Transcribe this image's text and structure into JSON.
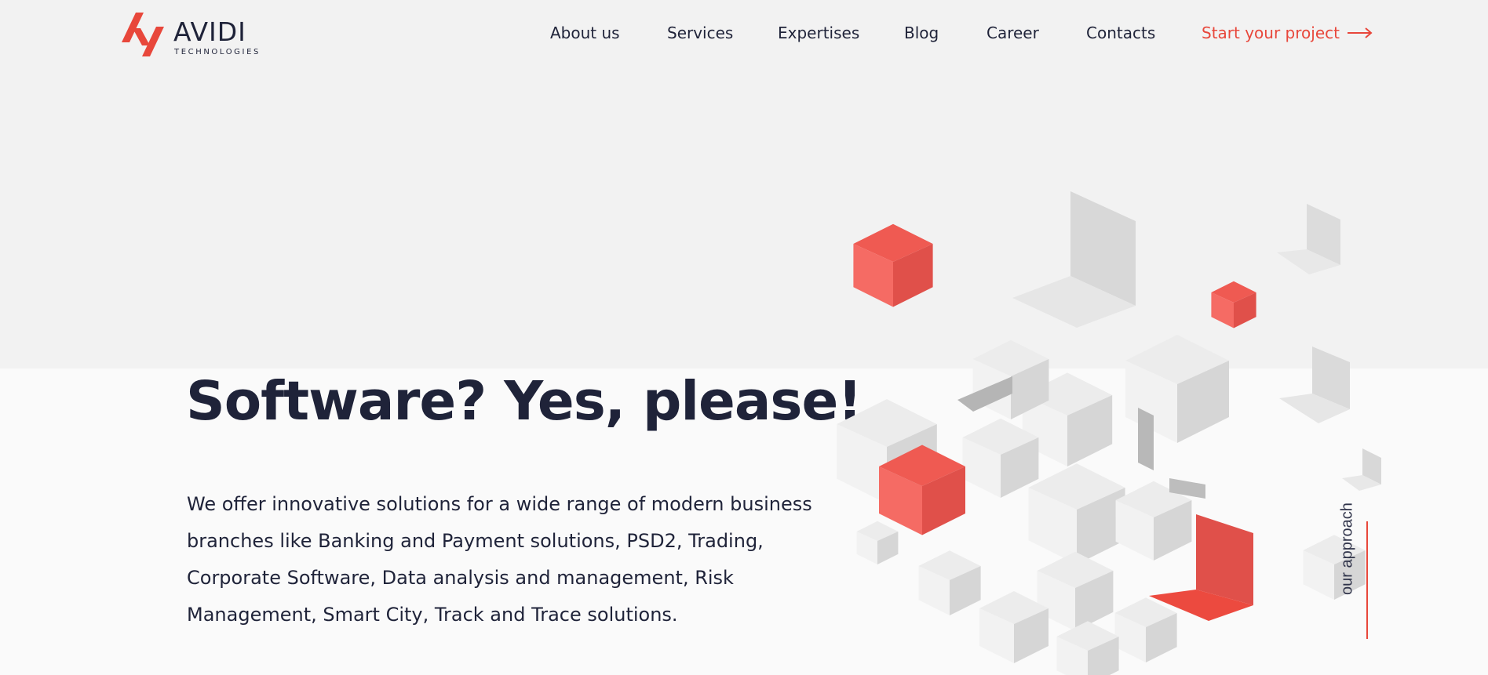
{
  "brand": {
    "name": "AVIDI",
    "tagline": "TECHNOLOGIES",
    "accent_color": "#e8473b",
    "text_color": "#1f2339"
  },
  "nav": {
    "items": [
      {
        "label": "About us"
      },
      {
        "label": "Services"
      },
      {
        "label": "Expertises"
      },
      {
        "label": "Blog"
      },
      {
        "label": "Career"
      },
      {
        "label": "Contacts"
      }
    ],
    "cta": {
      "label": "Start your project",
      "icon": "arrow-right-icon"
    }
  },
  "hero": {
    "title": "Software? Yes, please!",
    "description": "We offer innovative solutions for a wide range of modern business branches like Banking and Payment solutions, PSD2, Trading, Corporate Software, Data analysis and management, Risk Management, Smart City, Track and Trace solutions.",
    "illustration": "isometric-cubes-illustration"
  },
  "side_link": {
    "label": "our approach"
  }
}
